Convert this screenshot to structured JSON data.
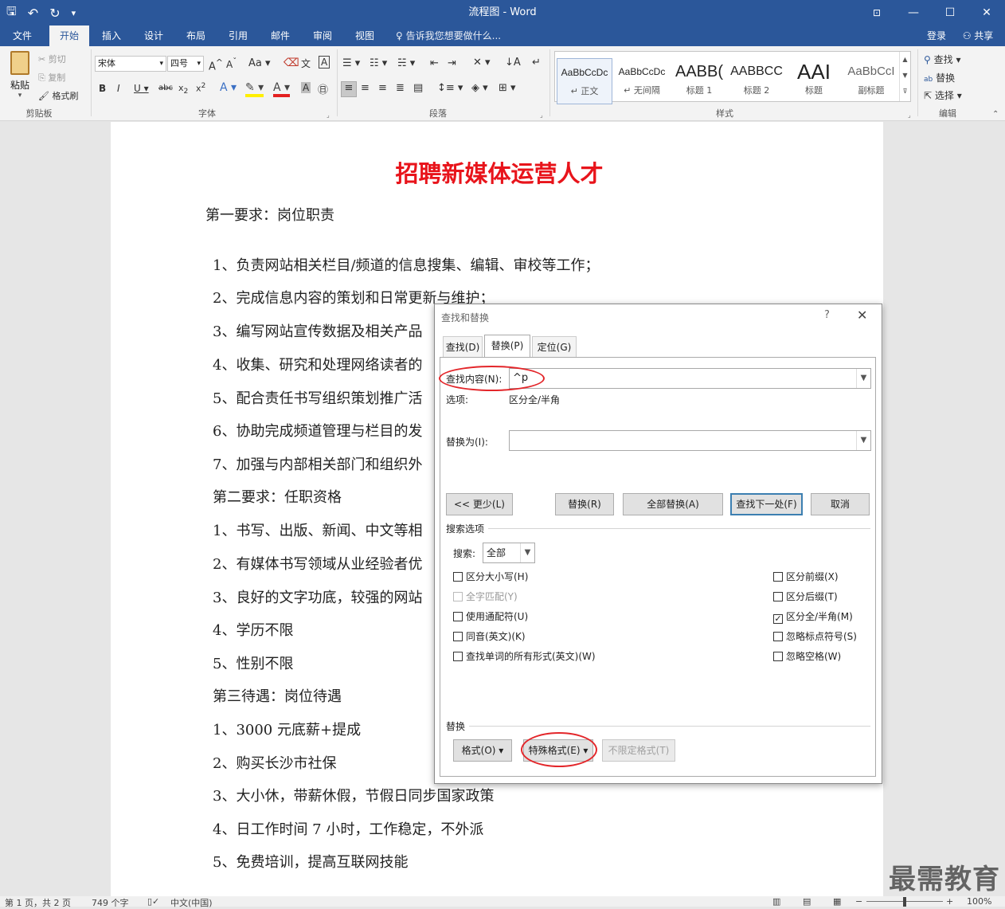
{
  "titlebar": {
    "title": "流程图 - Word",
    "minimize_icon": "—",
    "maximize_icon": "☐",
    "close_icon": "✕"
  },
  "ribbon_tabs": {
    "file": "文件",
    "home": "开始",
    "insert": "插入",
    "design": "设计",
    "layout": "布局",
    "references": "引用",
    "mailings": "邮件",
    "review": "审阅",
    "view": "视图",
    "tellme": "告诉我您想要做什么...",
    "signin": "登录",
    "share": "共享"
  },
  "clipboard": {
    "paste": "粘贴",
    "cut": "剪切",
    "copy": "复制",
    "format_painter": "格式刷",
    "label": "剪贴板"
  },
  "font": {
    "name": "宋体",
    "size": "四号",
    "label": "字体"
  },
  "paragraph": {
    "label": "段落"
  },
  "styles": {
    "label": "样式",
    "items": [
      {
        "sample": "AaBbCcDc",
        "name": "正文"
      },
      {
        "sample": "AaBbCcDc",
        "name": "无间隔"
      },
      {
        "sample": "AABB(",
        "name": "标题 1"
      },
      {
        "sample": "AABBCC",
        "name": "标题 2"
      },
      {
        "sample": "AAI",
        "name": "标题"
      },
      {
        "sample": "AaBbCcI",
        "name": "副标题"
      }
    ]
  },
  "editing": {
    "find": "查找",
    "replace": "替换",
    "select": "选择",
    "label": "编辑"
  },
  "document": {
    "title": "招聘新媒体运营人才",
    "lines": [
      "第一要求：岗位职责",
      "1、负责网站相关栏目/频道的信息搜集、编辑、审校等工作；",
      "2、完成信息内容的策划和日常更新与维护；",
      "3、编写网站宣传数据及相关产品",
      "4、收集、研究和处理网络读者的",
      "5、配合责任书写组织策划推广活",
      "6、协助完成频道管理与栏目的发",
      "7、加强与内部相关部门和组织外",
      "第二要求：任职资格",
      "1、书写、出版、新闻、中文等相",
      "2、有媒体书写领域从业经验者优",
      "3、良好的文字功底，较强的网站",
      "4、学历不限",
      "5、性别不限",
      "第三待遇：岗位待遇",
      "1、3000 元底薪+提成",
      "2、购买长沙市社保",
      "3、大小休，带薪休假，节假日同步国家政策",
      "4、日工作时间 7 小时，工作稳定，不外派",
      "5、免费培训，提高互联网技能"
    ]
  },
  "dialog": {
    "title": "查找和替换",
    "help": "?",
    "close": "✕",
    "tabs": {
      "find": "查找(D)",
      "replace": "替换(P)",
      "goto": "定位(G)"
    },
    "find_label": "查找内容(N):",
    "find_value": "^p",
    "options_label": "选项:",
    "options_value": "区分全/半角",
    "replace_label": "替换为(I):",
    "replace_value": "",
    "buttons": {
      "less": "<< 更少(L)",
      "replace": "替换(R)",
      "replace_all": "全部替换(A)",
      "find_next": "查找下一处(F)",
      "cancel": "取消"
    },
    "search_options_label": "搜索选项",
    "search_label": "搜索:",
    "search_value": "全部",
    "checks_left": [
      {
        "label": "区分大小写(H)",
        "checked": false,
        "disabled": false
      },
      {
        "label": "全字匹配(Y)",
        "checked": false,
        "disabled": true
      },
      {
        "label": "使用通配符(U)",
        "checked": false,
        "disabled": false
      },
      {
        "label": "同音(英文)(K)",
        "checked": false,
        "disabled": false
      },
      {
        "label": "查找单词的所有形式(英文)(W)",
        "checked": false,
        "disabled": false
      }
    ],
    "checks_right": [
      {
        "label": "区分前缀(X)",
        "checked": false
      },
      {
        "label": "区分后缀(T)",
        "checked": false
      },
      {
        "label": "区分全/半角(M)",
        "checked": true
      },
      {
        "label": "忽略标点符号(S)",
        "checked": false
      },
      {
        "label": "忽略空格(W)",
        "checked": false
      }
    ],
    "replace_section_label": "替换",
    "format_button": "格式(O) ▾",
    "special_button": "特殊格式(E) ▾",
    "no_format_button": "不限定格式(T)"
  },
  "statusbar": {
    "page": "第 1 页，共 2 页",
    "words": "749 个字",
    "lang": "中文(中国)",
    "zoom": "100%"
  },
  "watermark": "最需教育"
}
